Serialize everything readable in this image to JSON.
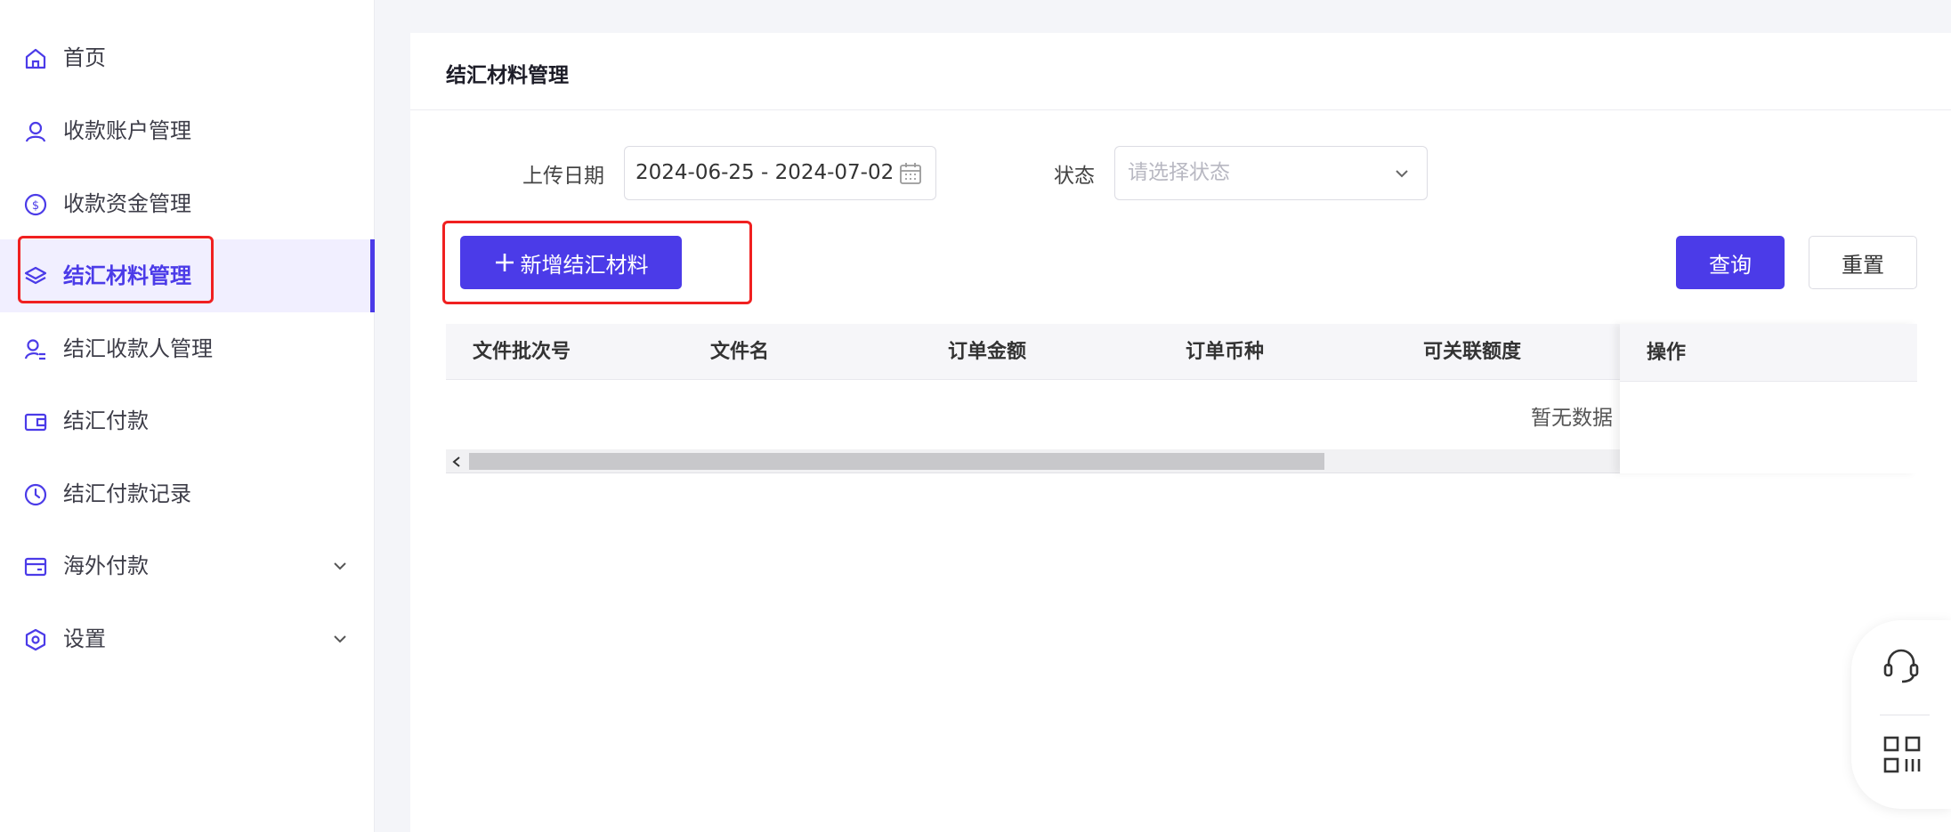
{
  "sidebar": {
    "items": [
      {
        "label": "首页",
        "icon": "home-icon"
      },
      {
        "label": "收款账户管理",
        "icon": "user-icon"
      },
      {
        "label": "收款资金管理",
        "icon": "dollar-circle-icon"
      },
      {
        "label": "结汇材料管理",
        "icon": "layers-icon",
        "active": true
      },
      {
        "label": "结汇收款人管理",
        "icon": "user-list-icon"
      },
      {
        "label": "结汇付款",
        "icon": "wallet-icon"
      },
      {
        "label": "结汇付款记录",
        "icon": "clock-icon"
      },
      {
        "label": "海外付款",
        "icon": "card-icon",
        "expandable": true
      },
      {
        "label": "设置",
        "icon": "hexagon-settings-icon",
        "expandable": true
      }
    ]
  },
  "page": {
    "title": "结汇材料管理"
  },
  "filters": {
    "upload_date_label": "上传日期",
    "upload_date_value": "2024-06-25 - 2024-07-02",
    "status_label": "状态",
    "status_placeholder": "请选择状态"
  },
  "actions": {
    "add_label": "新增结汇材料",
    "query_label": "查询",
    "reset_label": "重置"
  },
  "table": {
    "columns": [
      "文件批次号",
      "文件名",
      "订单金额",
      "订单币种",
      "可关联额度"
    ],
    "fixed_column": "操作",
    "empty_text": "暂无数据"
  },
  "colors": {
    "accent": "#4b3be8",
    "highlight": "#f02020"
  }
}
